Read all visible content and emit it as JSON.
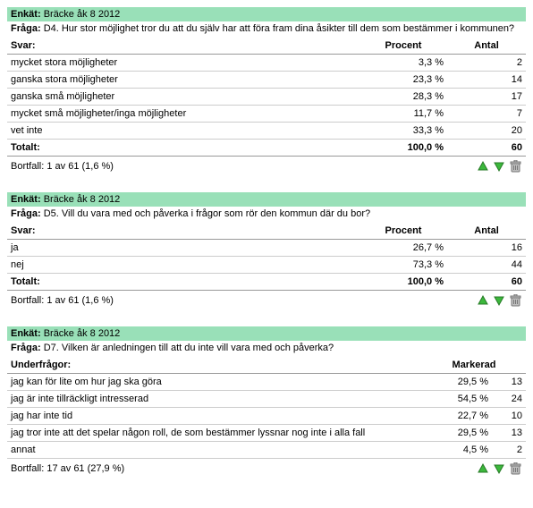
{
  "labels": {
    "enkat": "Enkät:",
    "fraga": "Fråga:",
    "svar": "Svar:",
    "procent": "Procent",
    "antal": "Antal",
    "totalt": "Totalt:",
    "underfragor": "Underfrågor:",
    "markerad": "Markerad"
  },
  "blocks": [
    {
      "survey": "Bräcke åk 8 2012",
      "question": "D4. Hur stor möjlighet tror du att du själv har att föra fram dina åsikter till dem som bestämmer i kommunen?",
      "type": "svar",
      "rows": [
        {
          "label": "mycket stora möjligheter",
          "procent": "3,3 %",
          "antal": "2"
        },
        {
          "label": "ganska stora möjligheter",
          "procent": "23,3 %",
          "antal": "14"
        },
        {
          "label": "ganska små möjligheter",
          "procent": "28,3 %",
          "antal": "17"
        },
        {
          "label": "mycket små möjligheter/inga möjligheter",
          "procent": "11,7 %",
          "antal": "7"
        },
        {
          "label": "vet inte",
          "procent": "33,3 %",
          "antal": "20"
        }
      ],
      "total": {
        "procent": "100,0 %",
        "antal": "60"
      },
      "bortfall": "Bortfall: 1 av 61 (1,6 %)"
    },
    {
      "survey": "Bräcke åk 8 2012",
      "question": "D5. Vill du vara med och påverka i frågor som rör den kommun där du bor?",
      "type": "svar",
      "rows": [
        {
          "label": "ja",
          "procent": "26,7 %",
          "antal": "16"
        },
        {
          "label": "nej",
          "procent": "73,3 %",
          "antal": "44"
        }
      ],
      "total": {
        "procent": "100,0 %",
        "antal": "60"
      },
      "bortfall": "Bortfall: 1 av 61 (1,6 %)"
    },
    {
      "survey": "Bräcke åk 8 2012",
      "question": "D7. Vilken är anledningen till att du inte vill vara med och påverka?",
      "type": "under",
      "rows": [
        {
          "label": "jag kan för lite om hur jag ska göra",
          "procent": "29,5 %",
          "antal": "13"
        },
        {
          "label": "jag är inte tillräckligt intresserad",
          "procent": "54,5 %",
          "antal": "24"
        },
        {
          "label": "jag har inte tid",
          "procent": "22,7 %",
          "antal": "10"
        },
        {
          "label": "jag tror inte att det spelar någon roll, de som bestämmer lyssnar nog inte i alla fall",
          "procent": "29,5 %",
          "antal": "13"
        },
        {
          "label": "annat",
          "procent": "4,5 %",
          "antal": "2"
        }
      ],
      "bortfall": "Bortfall: 17 av 61 (27,9 %)"
    }
  ]
}
